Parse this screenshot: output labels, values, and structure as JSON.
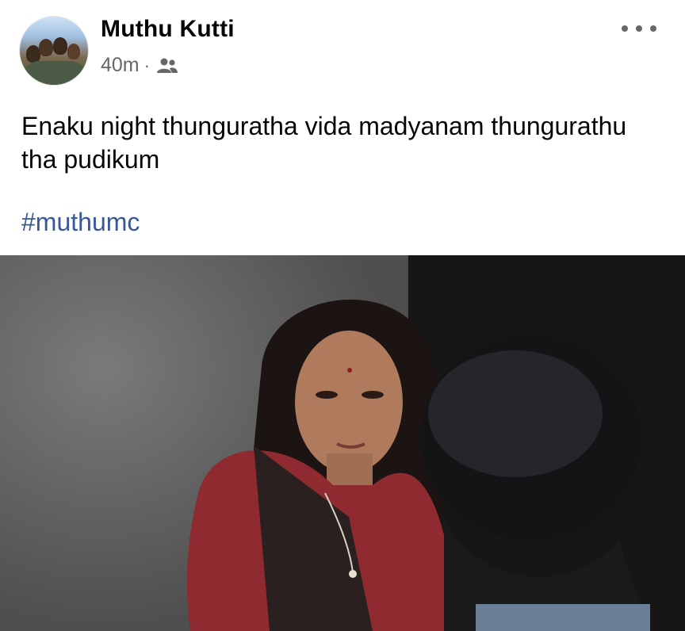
{
  "post": {
    "author": "Muthu Kutti",
    "time": "40m",
    "separator": "·",
    "audience_icon": "friends-icon",
    "more_icon": "more-options-icon",
    "text": "Enaku night thunguratha vida madyanam thungurathu tha pudikum",
    "hashtag": "#muthumc",
    "colors": {
      "name": "#050505",
      "meta": "#65676b",
      "hashtag": "#385898"
    }
  }
}
